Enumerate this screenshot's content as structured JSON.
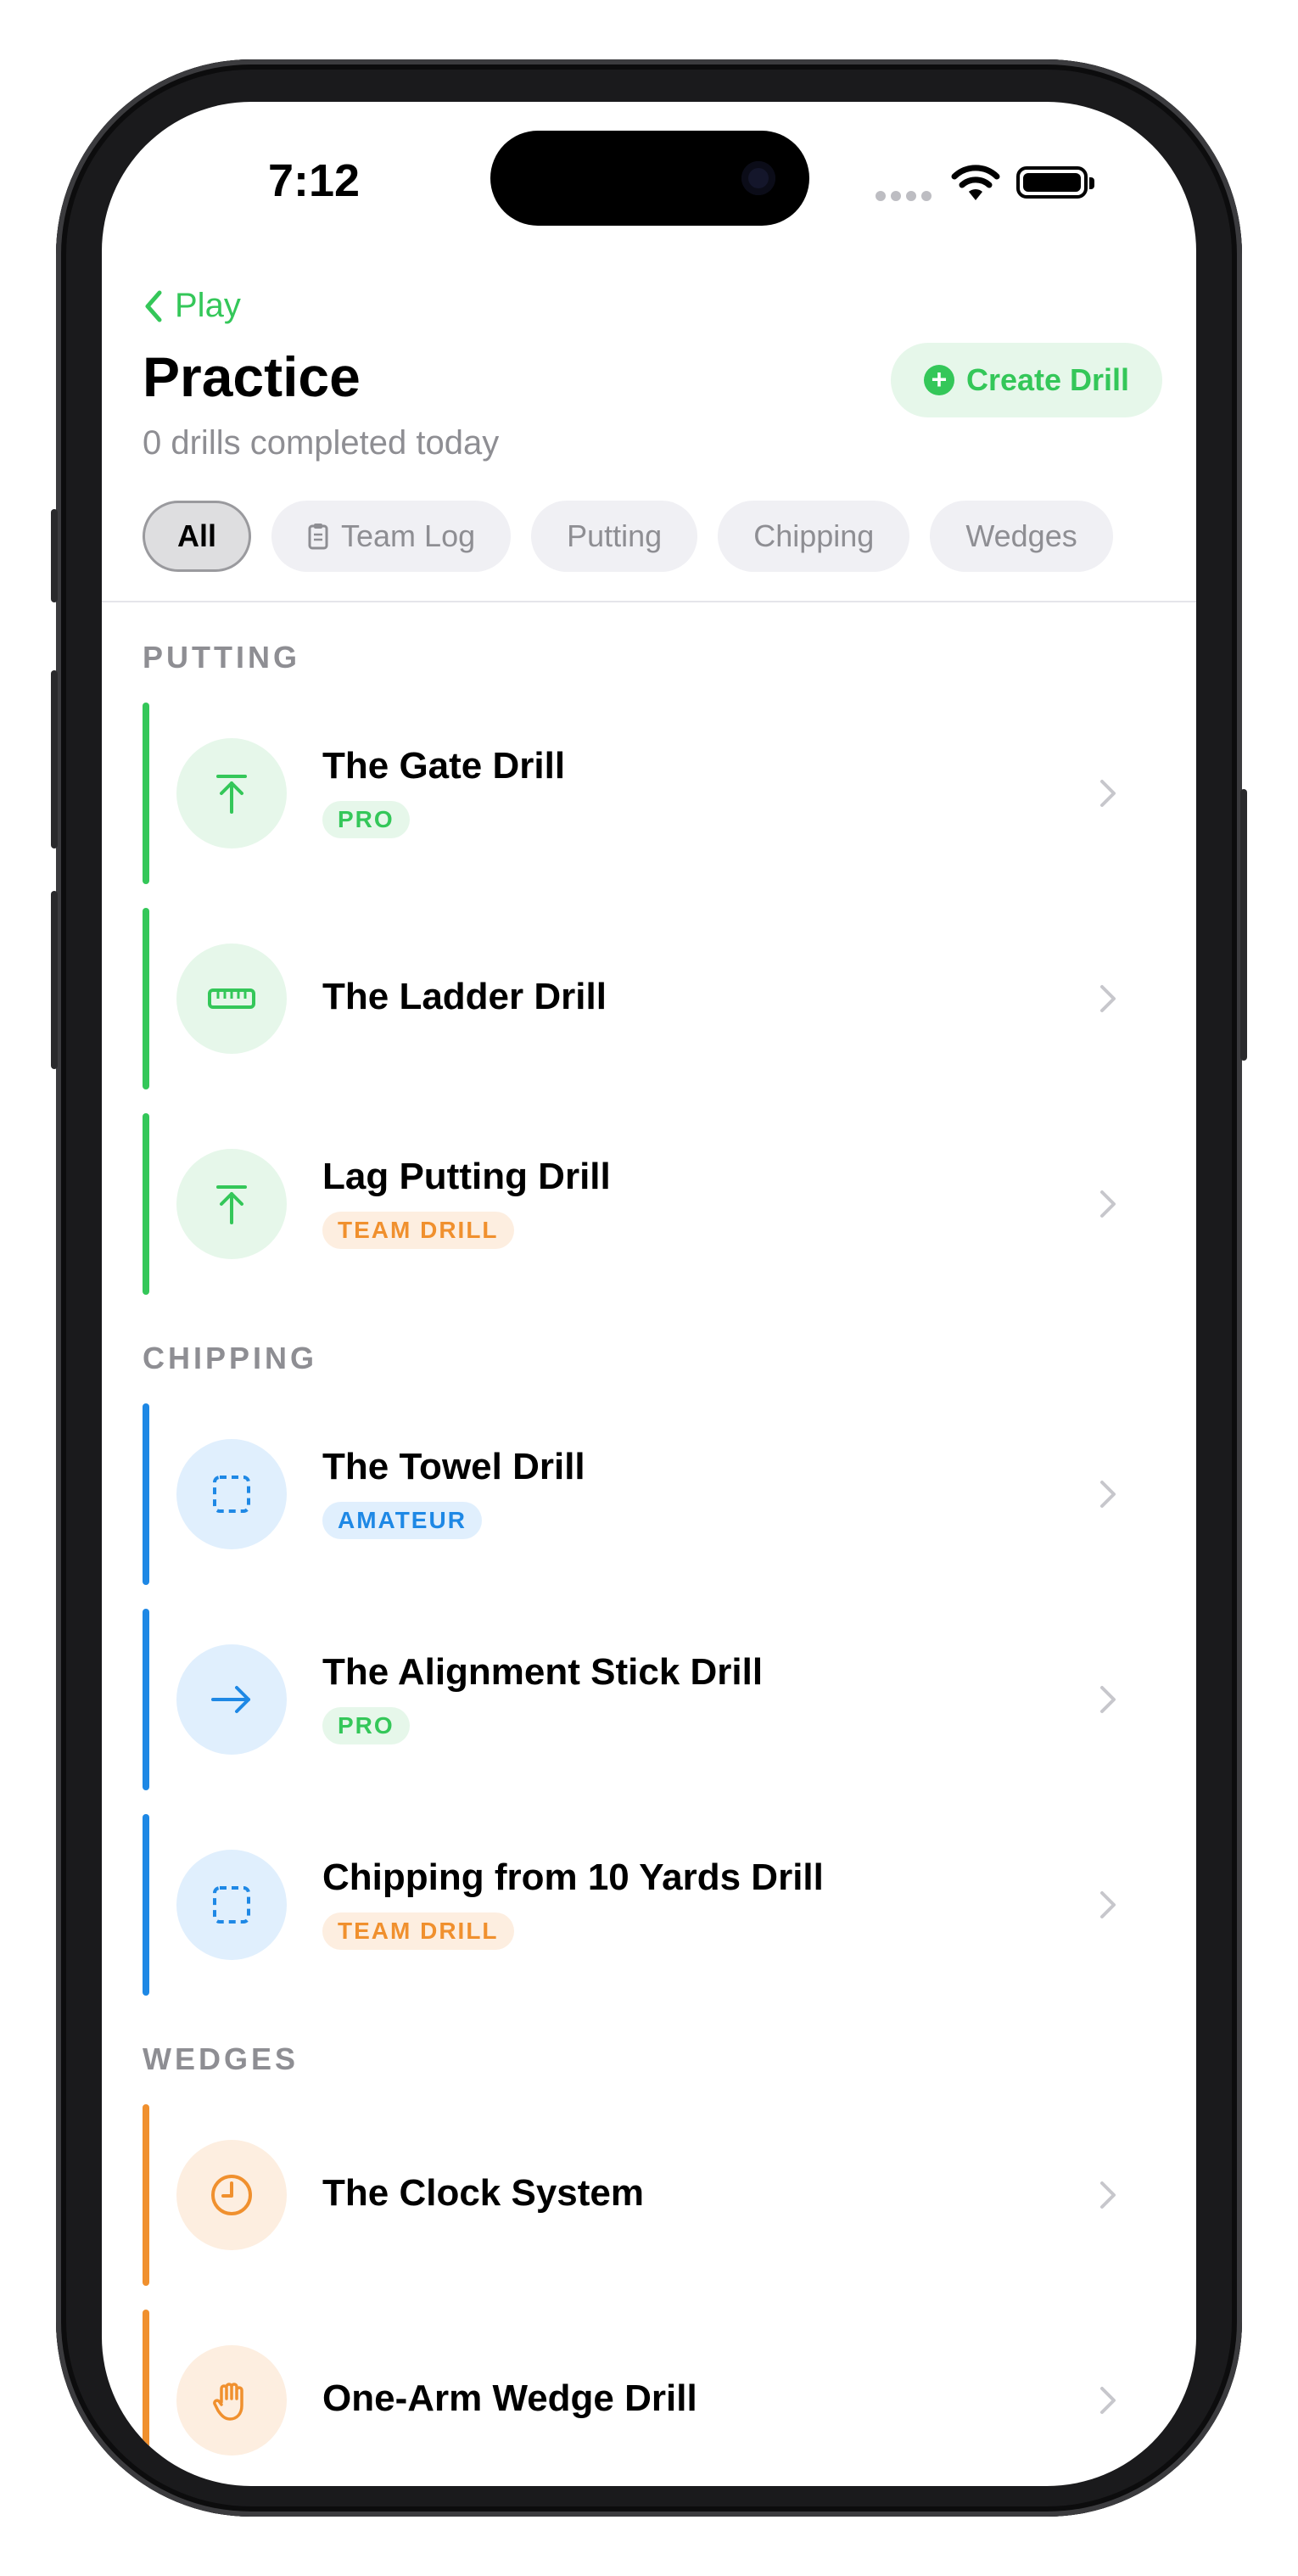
{
  "status_bar": {
    "time": "7:12"
  },
  "header": {
    "back_label": "Play",
    "title": "Practice",
    "subtitle": "0 drills completed today",
    "create_label": "Create Drill"
  },
  "filters": [
    {
      "label": "All",
      "active": true
    },
    {
      "label": "Team Log",
      "icon": "clipboard-icon"
    },
    {
      "label": "Putting"
    },
    {
      "label": "Chipping"
    },
    {
      "label": "Wedges"
    }
  ],
  "sections": [
    {
      "label": "PUTTING",
      "color": "#34c759",
      "drills": [
        {
          "name": "The Gate Drill",
          "tag": "PRO",
          "icon": "arrow-up-to-line-icon"
        },
        {
          "name": "The Ladder Drill",
          "tag": "",
          "icon": "ruler-icon"
        },
        {
          "name": "Lag Putting Drill",
          "tag": "TEAM DRILL",
          "icon": "arrow-up-to-line-icon"
        }
      ]
    },
    {
      "label": "CHIPPING",
      "color": "#1e88e5",
      "drills": [
        {
          "name": "The Towel Drill",
          "tag": "AMATEUR",
          "icon": "dashed-square-icon"
        },
        {
          "name": "The Alignment Stick Drill",
          "tag": "PRO",
          "icon": "arrow-right-icon"
        },
        {
          "name": "Chipping from 10 Yards Drill",
          "tag": "TEAM DRILL",
          "icon": "dashed-square-icon"
        }
      ]
    },
    {
      "label": "WEDGES",
      "color": "#f0902e",
      "drills": [
        {
          "name": "The Clock System",
          "tag": "",
          "icon": "clock-icon"
        },
        {
          "name": "One-Arm Wedge Drill",
          "tag": "",
          "icon": "hand-icon"
        }
      ]
    }
  ]
}
